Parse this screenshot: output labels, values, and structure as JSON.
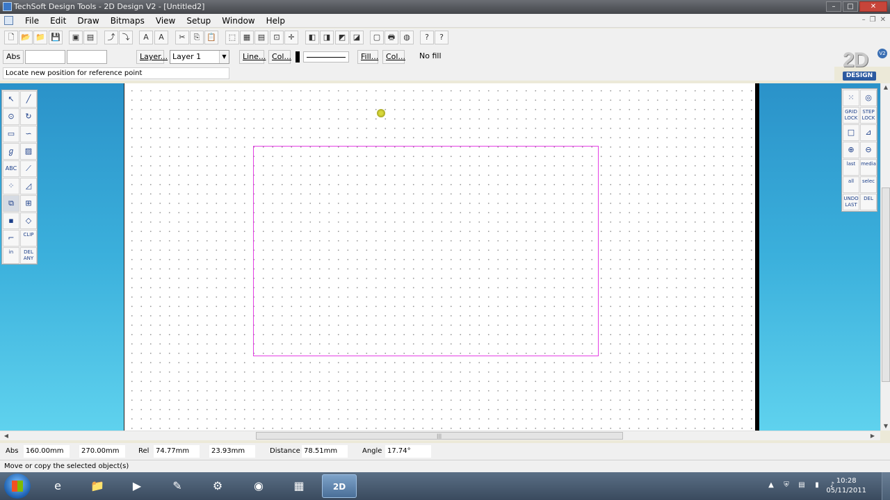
{
  "window": {
    "title": "TechSoft Design Tools - 2D Design V2 - [Untitled2]",
    "minimize": "–",
    "maximize": "□",
    "close": "✕"
  },
  "menu": {
    "items": [
      "File",
      "Edit",
      "Draw",
      "Bitmaps",
      "View",
      "Setup",
      "Window",
      "Help"
    ]
  },
  "toolbar2": {
    "abs_label": "Abs",
    "abs_x": "",
    "abs_y": "",
    "layer_button": "Layer...",
    "layer_selected": "Layer 1",
    "line_button": "Line...",
    "line_col_button": "Col...",
    "fill_button": "Fill...",
    "fill_col_button": "Col...",
    "fill_value": "No fill"
  },
  "logo": {
    "big": "2D",
    "version": "V2",
    "word": "DESIGN"
  },
  "prompt": "Locate new position for reference point",
  "left_tools": {
    "select": "↖",
    "line": "╱",
    "circle": "⊙",
    "arc": "↻",
    "rect": "▭",
    "curve": "∽",
    "spiral": "ℊ",
    "hatch": "▨",
    "text": "ABC",
    "dim": "⟋",
    "points": "⁘",
    "tri": "◿",
    "move": "⧉",
    "align": "⊞",
    "colour": "▪",
    "eraser": "◇",
    "poly": "⌐",
    "clip": "CLIP",
    "in_label": "in",
    "del_any": "DEL ANY"
  },
  "right_tools": {
    "grid": "⁙",
    "fill_tool": "◎",
    "grid_lock": "GRID LOCK",
    "step_lock": "STEP LOCK",
    "snap": "□",
    "axis": "⊿",
    "zoom_in": "⊕",
    "zoom_out": "⊖",
    "last": "last",
    "media": "media",
    "all": "all",
    "select": "selec",
    "undo_last": "UNDO LAST",
    "del": "DEL"
  },
  "coords": {
    "abs_label": "Abs",
    "abs_x": "160.00mm",
    "abs_y": "270.00mm",
    "rel_label": "Rel",
    "rel_x": "74.77mm",
    "rel_y": "23.93mm",
    "distance_label": "Distance",
    "distance": "78.51mm",
    "angle_label": "Angle",
    "angle": "17.74°"
  },
  "status": "Move or copy the selected object(s)",
  "taskbar": {
    "time": "10:28",
    "date": "05/11/2011",
    "apps": [
      "e",
      "📁",
      "▶",
      "✎",
      "⚙",
      "◉",
      "▦",
      "2D"
    ]
  },
  "colors": {
    "rect_stroke": "#e43ee4",
    "workspace_top": "#2a92c9",
    "workspace_bottom": "#5fd2ee"
  }
}
